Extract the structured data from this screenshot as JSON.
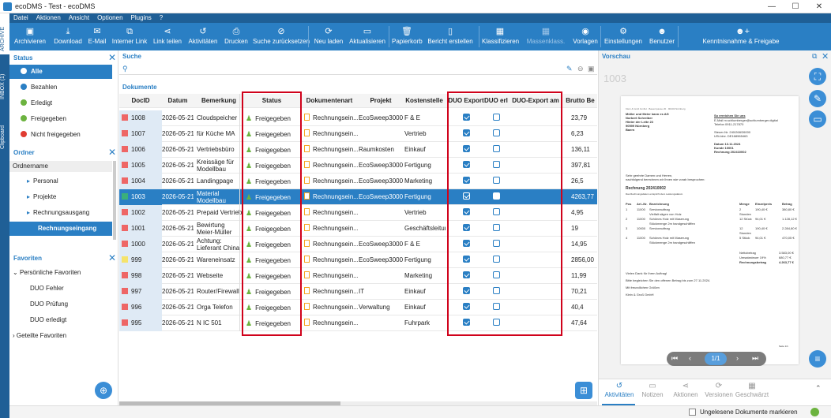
{
  "window": {
    "title": "ecoDMS - Test - ecoDMS",
    "min": "—",
    "max": "☐",
    "close": "✕"
  },
  "menu": [
    "Datei",
    "Aktionen",
    "Ansicht",
    "Optionen",
    "Plugins",
    "?"
  ],
  "toolbar": [
    {
      "label": "Archivieren",
      "icon": "▣"
    },
    {
      "label": "Download",
      "icon": "⤓"
    },
    {
      "label": "E-Mail",
      "icon": "✉"
    },
    {
      "label": "Interner Link",
      "icon": "⧉"
    },
    {
      "label": "Link teilen",
      "icon": "⋖"
    },
    {
      "label": "Aktivitäten",
      "icon": "↺"
    },
    {
      "label": "Drucken",
      "icon": "⎙"
    },
    {
      "label": "Suche zurücksetzen",
      "icon": "⊘"
    },
    {
      "label": "Neu laden",
      "icon": "⟳"
    },
    {
      "label": "Aktualisieren",
      "icon": "▭"
    },
    {
      "label": "Papierkorb",
      "icon": "🗑"
    },
    {
      "label": "Bericht erstellen",
      "icon": "▯"
    },
    {
      "label": "Klassifizieren",
      "icon": "▦"
    },
    {
      "label": "Massenklass.",
      "icon": "▦"
    },
    {
      "label": "Vorlagen",
      "icon": "◉"
    },
    {
      "label": "Einstellungen",
      "icon": "⚙"
    },
    {
      "label": "Benutzer",
      "icon": "☻"
    },
    {
      "label": "Kenntnisnahme & Freigabe",
      "icon": "☻+"
    }
  ],
  "sidetabs": [
    "ARCHIVE",
    "INBOX (1)",
    "Clipboard"
  ],
  "status_panel": {
    "title": "Status",
    "items": [
      {
        "label": "Alle",
        "color": "#1f5f96"
      },
      {
        "label": "Bezahlen",
        "color": "#2a7fc4"
      },
      {
        "label": "Erledigt",
        "color": "#6cb33f"
      },
      {
        "label": "Freigegeben",
        "color": "#6cb33f"
      },
      {
        "label": "Nicht freigegeben",
        "color": "#e03c31"
      }
    ]
  },
  "ordner_panel": {
    "title": "Ordner",
    "header": "Ordnername",
    "items": [
      "Personal",
      "Projekte",
      "Rechnungsausgang",
      "Rechnungseingang"
    ]
  },
  "favoriten_panel": {
    "title": "Favoriten",
    "group1": "Persönliche Favoriten",
    "items": [
      "DUO Fehler",
      "DUO Prüfung",
      "DUO erledigt"
    ],
    "group2": "Geteilte Favoriten"
  },
  "search": {
    "title": "Suche",
    "section": "Dokumente"
  },
  "columns": [
    "DocID",
    "Datum",
    "Bemerkung",
    "Status",
    "Dokumentenart",
    "Projekt",
    "Kostenstelle",
    "DUO Export",
    "DUO erl.",
    "DUO-Export am",
    "Brutto Be"
  ],
  "rows": [
    {
      "id": "1008",
      "date": "2026-05-21",
      "note": "Cloudspeicher",
      "status": "Freigegeben",
      "art": "Rechnungsein...",
      "projekt": "EcoSweep3000",
      "kst": "F & E",
      "exp": true,
      "erl": false,
      "brutto": "23,79"
    },
    {
      "id": "1007",
      "date": "2026-05-21",
      "note": "für Küche MA",
      "status": "Freigegeben",
      "art": "Rechnungsein...",
      "projekt": "",
      "kst": "Vertrieb",
      "exp": true,
      "erl": false,
      "brutto": "6,23"
    },
    {
      "id": "1006",
      "date": "2026-05-21",
      "note": "Vertriebsbüro",
      "status": "Freigegeben",
      "art": "Rechnungsein...",
      "projekt": "Raumkosten",
      "kst": "Einkauf",
      "exp": true,
      "erl": false,
      "brutto": "136,11"
    },
    {
      "id": "1005",
      "date": "2026-05-21",
      "note": "Kreissäge für Modellbau",
      "status": "Freigegeben",
      "art": "Rechnungsein...",
      "projekt": "EcoSweep3000",
      "kst": "Fertigung",
      "exp": true,
      "erl": false,
      "brutto": "397,81"
    },
    {
      "id": "1004",
      "date": "2026-05-21",
      "note": "Landingpage",
      "status": "Freigegeben",
      "art": "Rechnungsein...",
      "projekt": "EcoSweep3000",
      "kst": "Marketing",
      "exp": true,
      "erl": false,
      "brutto": "26,5"
    },
    {
      "id": "1003",
      "date": "2026-05-21",
      "note": "Material Modellbau",
      "status": "Freigegeben",
      "art": "Rechnungsein...",
      "projekt": "EcoSweep3000",
      "kst": "Fertigung",
      "exp": true,
      "erl": false,
      "brutto": "4263,77"
    },
    {
      "id": "1002",
      "date": "2026-05-21",
      "note": "Prepaid Vertrieb",
      "status": "Freigegeben",
      "art": "Rechnungsein...",
      "projekt": "",
      "kst": "Vertrieb",
      "exp": true,
      "erl": false,
      "brutto": "4,95"
    },
    {
      "id": "1001",
      "date": "2026-05-21",
      "note": "Bewirtung Meier-Müller",
      "status": "Freigegeben",
      "art": "Rechnungsein...",
      "projekt": "",
      "kst": "Geschäftsleitung",
      "exp": true,
      "erl": false,
      "brutto": "19"
    },
    {
      "id": "1000",
      "date": "2026-05-21",
      "note": "Achtung: Lieferant China",
      "status": "Freigegeben",
      "art": "Rechnungsein...",
      "projekt": "EcoSweep3000",
      "kst": "F & E",
      "exp": true,
      "erl": false,
      "brutto": "14,95"
    },
    {
      "id": "999",
      "date": "2026-05-21",
      "note": "Wareneinsatz",
      "status": "Freigegeben",
      "art": "Rechnungsein...",
      "projekt": "EcoSweep3000",
      "kst": "Fertigung",
      "exp": true,
      "erl": false,
      "brutto": "2856,00"
    },
    {
      "id": "998",
      "date": "2026-05-21",
      "note": "Webseite Bestand",
      "status": "Freigegeben",
      "art": "Rechnungsein...",
      "projekt": "",
      "kst": "Marketing",
      "exp": true,
      "erl": false,
      "brutto": "11,99"
    },
    {
      "id": "997",
      "date": "2026-05-21",
      "note": "Router/Firewall",
      "status": "Freigegeben",
      "art": "Rechnungsein...",
      "projekt": "IT",
      "kst": "Einkauf",
      "exp": true,
      "erl": false,
      "brutto": "70,21"
    },
    {
      "id": "996",
      "date": "2026-05-21",
      "note": "Orga Telefon",
      "status": "Freigegeben",
      "art": "Rechnungsein...",
      "projekt": "Verwaltung",
      "kst": "Einkauf",
      "exp": true,
      "erl": false,
      "brutto": "40,4"
    },
    {
      "id": "995",
      "date": "2026-05-21",
      "note": "N IC 501",
      "status": "Freigegeben",
      "art": "Rechnungsein...",
      "projekt": "",
      "kst": "Fuhrpark",
      "exp": true,
      "erl": false,
      "brutto": "47,64"
    }
  ],
  "preview": {
    "title": "Vorschau",
    "docid": "1003",
    "sender": "Klein & Groß GmbH · Bauernpasse 20 · 90443 Nürnberg",
    "recipient": [
      "Müller und Meier kann es AG",
      "Norbert Schreiber",
      "Hinter der Leite 23",
      "90599 Nürnberg",
      "Baern"
    ],
    "contact_title": "So erreichen Sie uns",
    "contact": [
      "E-Mail   m.schlumberger@schlumberger.digital",
      "Telefon   0911-217870",
      "",
      "Steuer-Nr.   240/268/26000",
      "USt-Idnr.   DE168965463",
      "",
      "Datum   13.11.2024",
      "Kunde   10001",
      "Rechnung   202410002"
    ],
    "greeting": "Sehr geehrte Damen und Herren,",
    "greeting2": "nachfolgend berechnen wir Ihnen wie vorab besprochen:",
    "invoice_title": "Rechnung 202410002",
    "invoice_sub": "Das Rechnungsdatum entspricht dem Leistungsdatum",
    "table_head": [
      "Pos",
      "Art.-Nr.",
      "Bezeichnung",
      "Menge",
      "Einzelpreis",
      "Betrag"
    ],
    "table_rows": [
      [
        "1",
        "11000",
        "Serviceauftrag",
        "2",
        "190,40 €",
        "380,80 €"
      ],
      [
        "",
        "",
        "Vielfalt sägen von Holz",
        "Stunden",
        "",
        ""
      ],
      [
        "2",
        "11000",
        "Schönes Holz mit Maserung",
        "12 Stück",
        "94,01 €",
        "1.128,12 €"
      ],
      [
        "",
        "",
        "Stückmenge 2m handgeschliffen",
        "",
        "",
        ""
      ],
      [
        "3",
        "10000",
        "Serviceauftrag",
        "12",
        "190,40 €",
        "2.284,80 €"
      ],
      [
        "",
        "",
        "",
        "Stunden",
        "",
        ""
      ],
      [
        "4",
        "11000",
        "Schönes Holz mit Maserung",
        "5 Stück",
        "94,01 €",
        "470,05 €"
      ],
      [
        "",
        "",
        "Stückmenge 2m handgeschliffen",
        "",
        "",
        ""
      ]
    ],
    "totals": [
      [
        "Nettobetrag",
        "3.583,00 €"
      ],
      [
        "Umsatzsteuer 19%",
        "680,77 €"
      ],
      [
        "Rechnungsbetrag",
        "4.263,77 €"
      ]
    ],
    "thanks": "Vielen Dank für Ihren Auftrag!",
    "pay": "Bitte begleichen Sie den offenen Betrag bis zum 27.11.2024.",
    "regards": "Mit freundlichen Grüßen",
    "company": "Klein & Groß GmbH",
    "page": "Seite 1/1",
    "pager": "1/1"
  },
  "bottom_tabs": [
    "Aktivitäten",
    "Notizen",
    "Aktionen",
    "Versionen",
    "Geschwärzt"
  ],
  "statusbar": {
    "checkbox_label": "Ungelesene Dokumente markieren"
  }
}
